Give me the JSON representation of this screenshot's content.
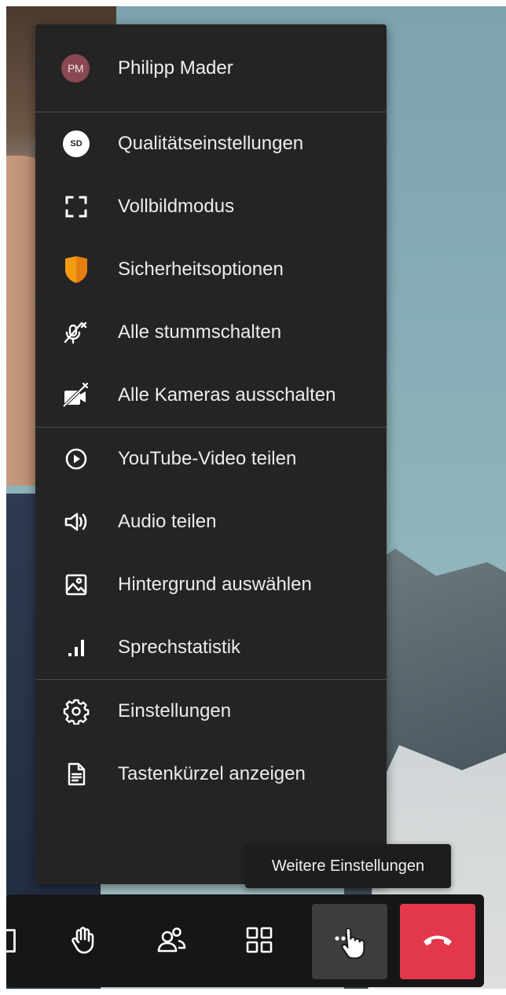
{
  "user": {
    "initials": "PM",
    "name": "Philipp Mader",
    "avatar_color": "#8a4754"
  },
  "menu": {
    "sections": [
      [
        {
          "icon": "sd-badge-icon",
          "badge": "SD",
          "label": "Qualitätseinstellungen"
        },
        {
          "icon": "fullscreen-icon",
          "label": "Vollbildmodus"
        },
        {
          "icon": "shield-icon",
          "label": "Sicherheitsoptionen"
        },
        {
          "icon": "mute-all-icon",
          "label": "Alle stummschalten"
        },
        {
          "icon": "camera-off-all-icon",
          "label": "Alle Kameras ausschalten"
        }
      ],
      [
        {
          "icon": "play-circle-icon",
          "label": "YouTube-Video teilen"
        },
        {
          "icon": "speaker-icon",
          "label": "Audio teilen"
        },
        {
          "icon": "image-icon",
          "label": "Hintergrund auswählen"
        },
        {
          "icon": "signal-bars-icon",
          "label": "Sprechstatistik"
        }
      ],
      [
        {
          "icon": "gear-icon",
          "label": "Einstellungen"
        },
        {
          "icon": "document-icon",
          "label": "Tastenkürzel anzeigen"
        }
      ]
    ]
  },
  "tooltip": "Weitere Einstellungen",
  "toolbar": {
    "buttons": [
      "raise-hand-icon",
      "participants-icon",
      "tile-view-icon",
      "more-options-icon",
      "hangup-icon"
    ],
    "hangup_color": "#e3374b",
    "shield_color": "#f39c12"
  }
}
